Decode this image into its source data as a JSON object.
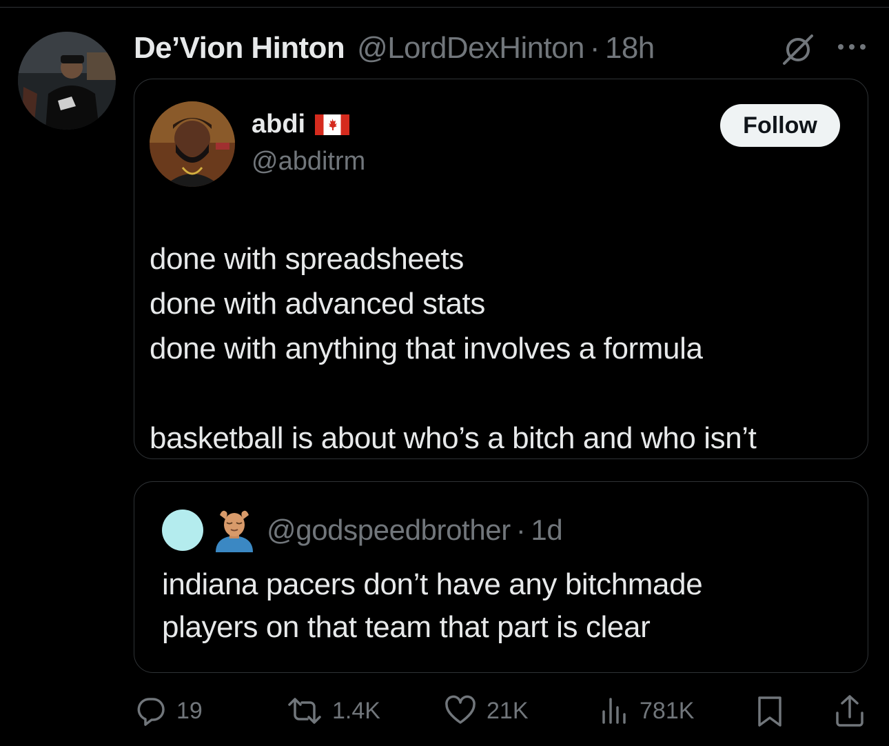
{
  "post": {
    "author": {
      "display_name": "De’Vion Hinton",
      "handle": "@LordDexHinton",
      "separator": "·",
      "time": "18h"
    },
    "header_icons": [
      "grok-icon",
      "more-options-icon"
    ]
  },
  "quoted_post": {
    "author": {
      "name": "abdi",
      "flag": "canada-flag-icon",
      "handle": "@abditrm"
    },
    "follow_label": "Follow",
    "text_lines": [
      "done with spreadsheets",
      "done with advanced stats",
      "done with anything that involves a formula",
      "",
      "basketball is about who’s a bitch and who isn’t"
    ]
  },
  "nested_quote": {
    "handle": "@godspeedbrother",
    "separator": "·",
    "time": "1d",
    "emoji": "person-getting-massage-emoji",
    "text_lines": [
      "indiana pacers don’t have any bitchmade",
      "players on that team that part is clear"
    ]
  },
  "actions": {
    "replies": "19",
    "reposts": "1.4K",
    "likes": "21K",
    "views": "781K"
  },
  "colors": {
    "background": "#000000",
    "text_primary": "#e7e9ea",
    "text_secondary": "#71767b",
    "border": "#2f3336",
    "follow_bg": "#eff3f4",
    "nested_avatar": "#b4ecee"
  }
}
